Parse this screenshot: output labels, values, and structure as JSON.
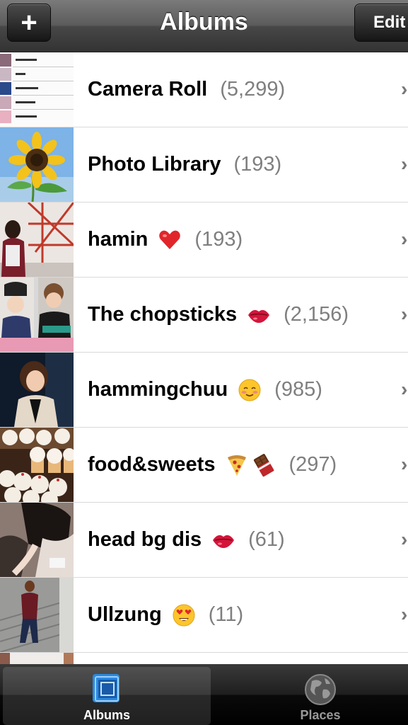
{
  "navbar": {
    "title": "Albums",
    "add_label": "+",
    "edit_label": "Edit"
  },
  "albums": [
    {
      "name": "Camera Roll",
      "count": "(5,299)",
      "emoji": ""
    },
    {
      "name": "Photo Library",
      "count": "(193)",
      "emoji": ""
    },
    {
      "name": "hamin",
      "count": "(193)",
      "emoji": "heart"
    },
    {
      "name": "The chopsticks",
      "count": "(2,156)",
      "emoji": "kiss-lips"
    },
    {
      "name": "hammingchuu",
      "count": "(985)",
      "emoji": "blush-face"
    },
    {
      "name": "food&sweets",
      "count": "(297)",
      "emoji": "pizza-chocolate"
    },
    {
      "name": "head bg dis",
      "count": "(61)",
      "emoji": "kiss-lips"
    },
    {
      "name": "Ullzung",
      "count": "(11)",
      "emoji": "heart-eyes-face"
    }
  ],
  "tabs": [
    {
      "label": "Albums",
      "icon": "albums-icon",
      "selected": true
    },
    {
      "label": "Places",
      "icon": "globe-icon",
      "selected": false
    }
  ]
}
